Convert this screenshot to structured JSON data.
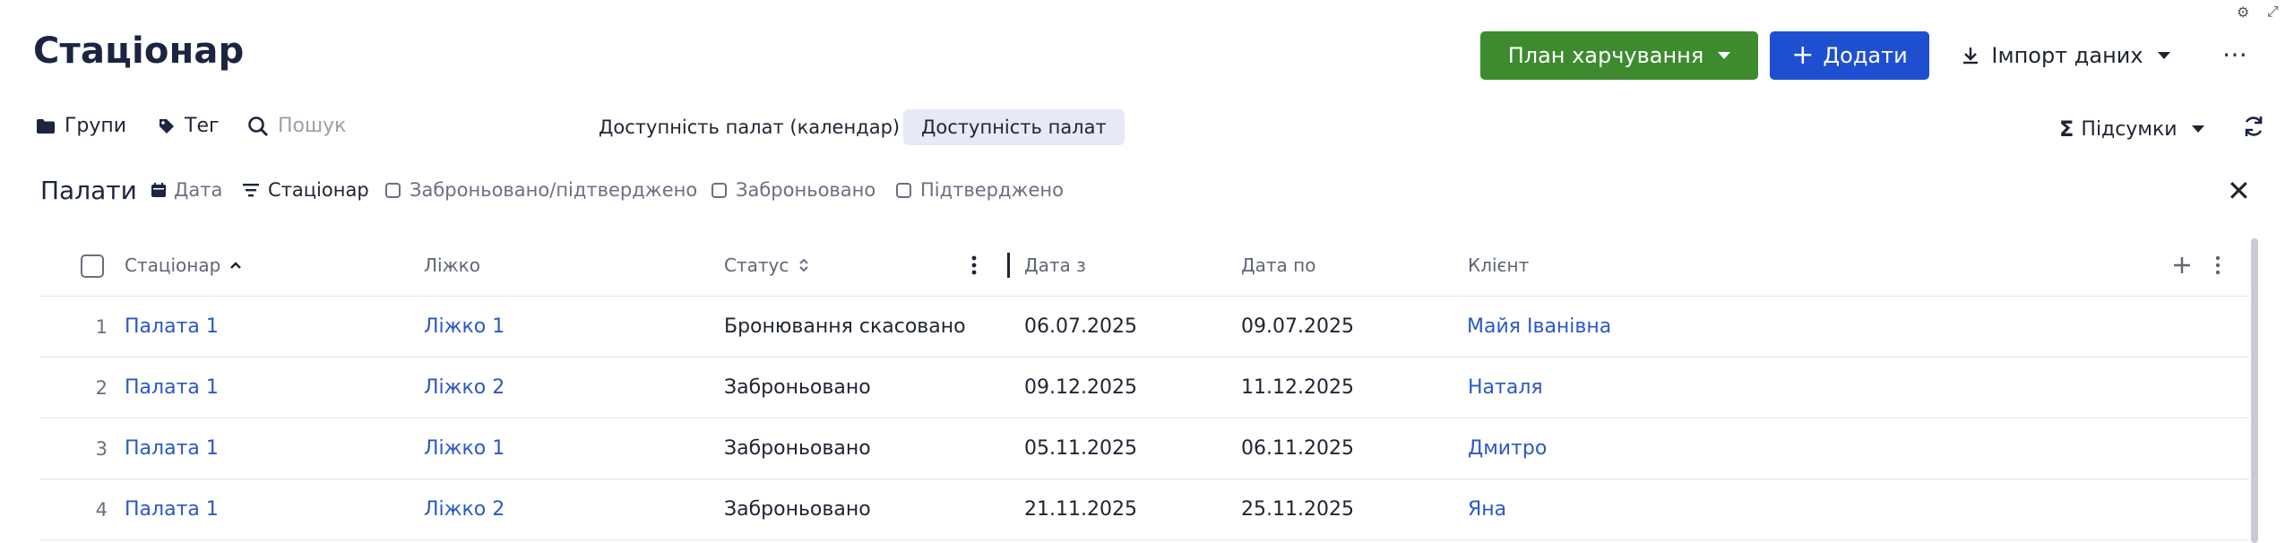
{
  "header": {
    "title": "Стаціонар",
    "meal_plan_label": "План харчування",
    "add_label": "Додати",
    "add_prefix": "+",
    "import_label": "Імпорт даних",
    "more_label": "⋯"
  },
  "toolbar": {
    "groups_label": "Групи",
    "tag_label": "Тег",
    "search_placeholder": "Пошук",
    "view_calendar_label": "Доступність палат (календар)",
    "view_list_label": "Доступність палат",
    "totals_label": "Підсумки"
  },
  "filters": {
    "section_title": "Палати",
    "date_label": "Дата",
    "ward_label": "Стаціонар",
    "booked_confirmed_label": "Заброньовано/підтверджено",
    "booked_label": "Заброньовано",
    "confirmed_label": "Підтверджено"
  },
  "table": {
    "columns": [
      "Стаціонар",
      "Ліжко",
      "Статус",
      "Дата з",
      "Дата по",
      "Клієнт"
    ],
    "rows": [
      {
        "n": "1",
        "ward": "Палата 1",
        "bed": "Ліжко 1",
        "status": "Бронювання скасовано",
        "from": "06.07.2025",
        "to": "09.07.2025",
        "client": "Майя Іванівна"
      },
      {
        "n": "2",
        "ward": "Палата 1",
        "bed": "Ліжко 2",
        "status": "Заброньовано",
        "from": "09.12.2025",
        "to": "11.12.2025",
        "client": "Наталя"
      },
      {
        "n": "3",
        "ward": "Палата 1",
        "bed": "Ліжко 1",
        "status": "Заброньовано",
        "from": "05.11.2025",
        "to": "06.11.2025",
        "client": "Дмитро"
      },
      {
        "n": "4",
        "ward": "Палата 1",
        "bed": "Ліжко 2",
        "status": "Заброньовано",
        "from": "21.11.2025",
        "to": "25.11.2025",
        "client": "Яна"
      }
    ]
  },
  "colors": {
    "primary_green": "#3d8b2e",
    "primary_blue": "#1f4fd1",
    "link": "#2b57c9",
    "active_tab_bg": "#e6eaf7"
  },
  "icons": [
    "gear-icon",
    "expand-icon",
    "caret-down-icon",
    "plus-icon",
    "download-icon",
    "folder-icon",
    "tag-icon",
    "search-icon",
    "sigma-icon",
    "refresh-icon",
    "calendar-icon",
    "filter-icon",
    "close-icon",
    "sort-asc-icon",
    "sort-both-icon",
    "kebab-icon"
  ]
}
